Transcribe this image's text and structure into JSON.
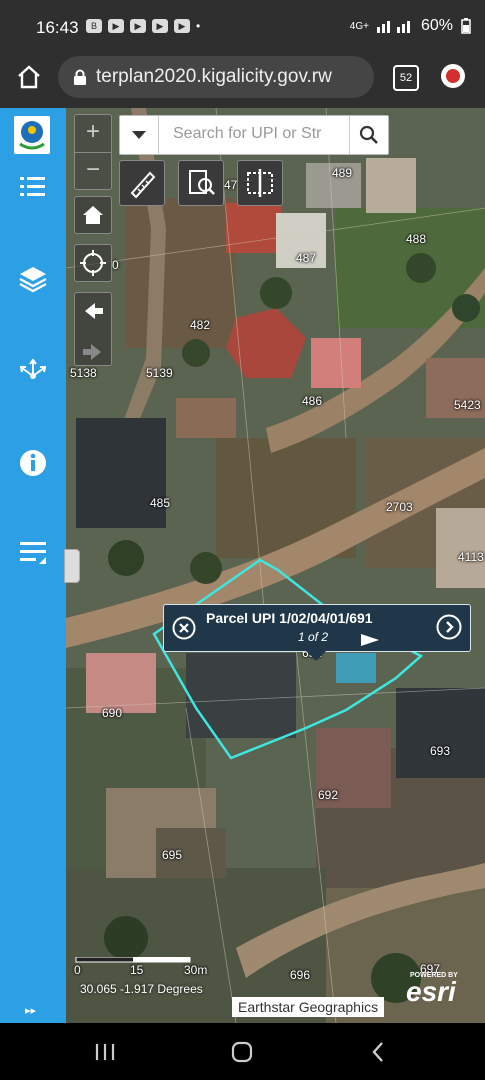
{
  "status_bar": {
    "time": "16:43",
    "network": "4G+",
    "battery": "60%"
  },
  "browser": {
    "url": "terplan2020.kigalicity.gov.rw",
    "tab_count": "52"
  },
  "sidebar": {
    "items": [
      {
        "icon": "list-icon"
      },
      {
        "icon": "layers-icon"
      },
      {
        "icon": "share-icon"
      },
      {
        "icon": "info-icon"
      },
      {
        "icon": "menu-edit-icon"
      }
    ],
    "collapse": "▸▸"
  },
  "map": {
    "zoom_in": "+",
    "zoom_out": "−",
    "search_placeholder": "Search for UPI or Str",
    "parcel_labels": [
      {
        "text": "489"
      },
      {
        "text": "488"
      },
      {
        "text": "487"
      },
      {
        "text": "47"
      },
      {
        "text": "0"
      },
      {
        "text": "482"
      },
      {
        "text": "5138"
      },
      {
        "text": "5139"
      },
      {
        "text": "486"
      },
      {
        "text": "5423"
      },
      {
        "text": "485"
      },
      {
        "text": "2703"
      },
      {
        "text": "4113"
      },
      {
        "text": "690"
      },
      {
        "text": "693"
      },
      {
        "text": "692"
      },
      {
        "text": "695"
      },
      {
        "text": "696"
      },
      {
        "text": "697"
      },
      {
        "text": "691"
      }
    ],
    "popup": {
      "title": "Parcel UPI 1/02/04/01/691",
      "pager": "1 of 2"
    },
    "scale": {
      "zero": "0",
      "mid": "15",
      "end": "30m"
    },
    "coordinates": "30.065 -1.917 Degrees",
    "attribution": "Earthstar Geographics",
    "powered_by": "POWERED BY",
    "esri": "esri"
  },
  "colors": {
    "sidebar": "#2c9fe5",
    "popup": "#1f3749",
    "parcel_outline": "#3ee6e0"
  }
}
